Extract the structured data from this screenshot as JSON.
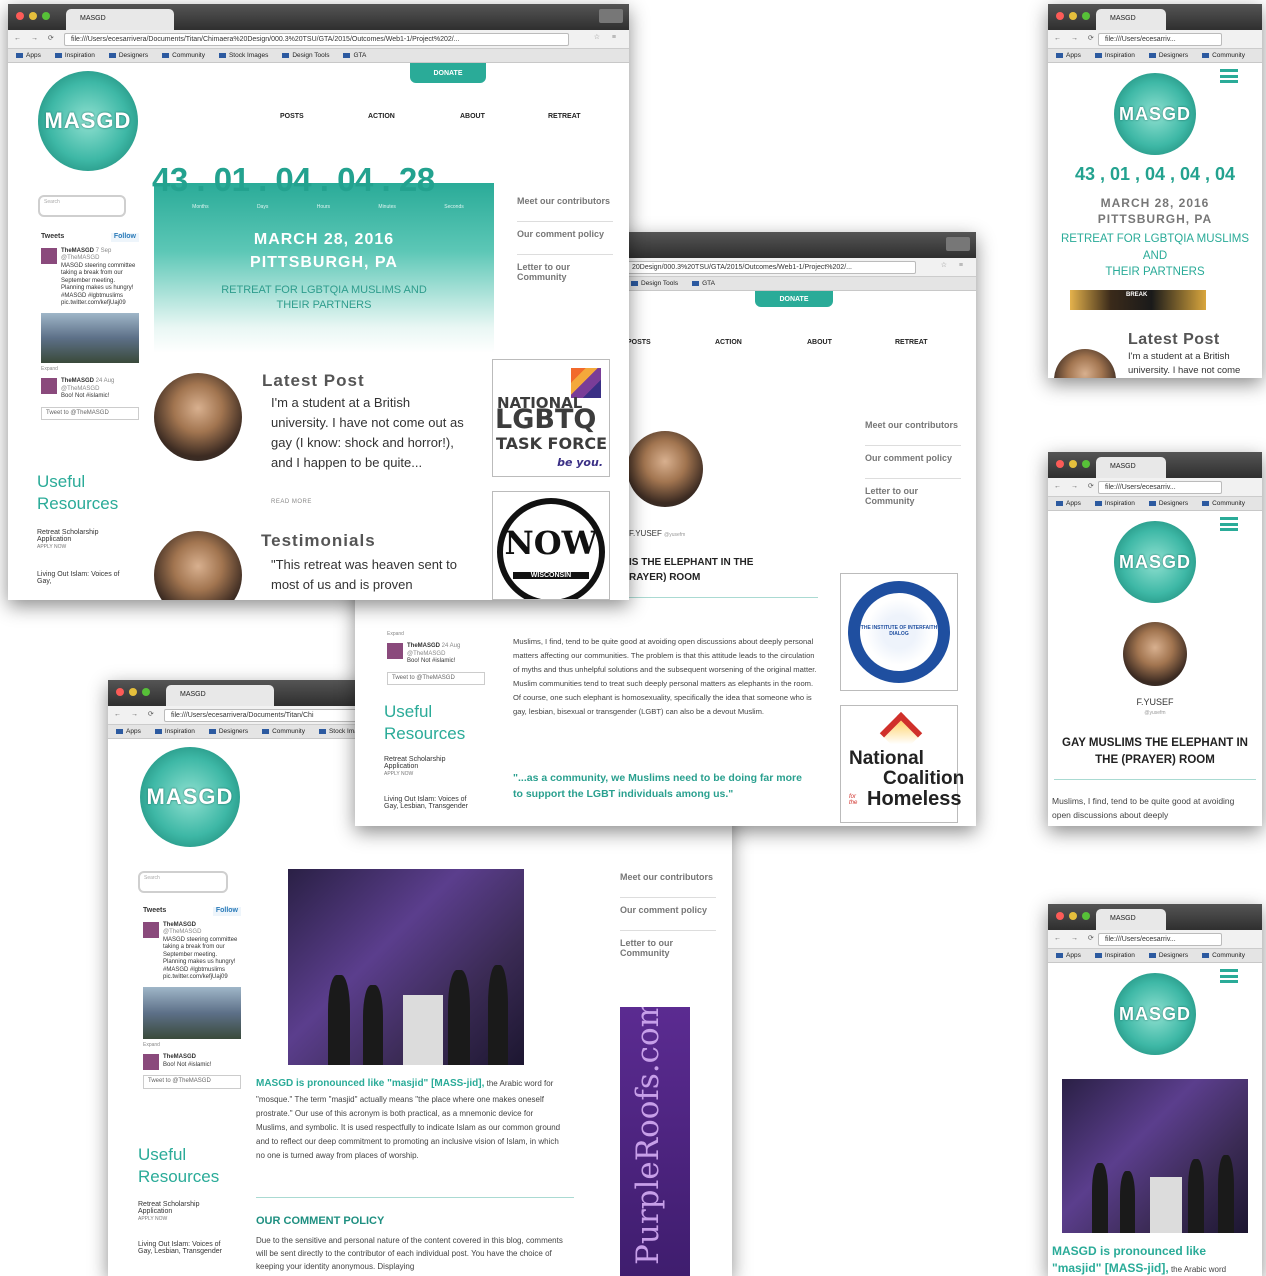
{
  "tab": {
    "title": "MASGD"
  },
  "url": {
    "w1": "file:///Users/ecesarrivera/Documents/Titan/Chimaera%20Design/000.3%20TSU/GTA/2015/Outcomes/Web1-1/Project%202/...",
    "w2": "20Design/000.3%20TSU/GTA/2015/Outcomes/Web1-1/Project%202/...",
    "w3": "file:///Users/ecesarrivera/Documents/Titan/Chi",
    "m": "file:///Users/ecesarriv..."
  },
  "bookmarks": [
    "Apps",
    "Inspiration",
    "Designers",
    "Community",
    "Stock Images",
    "Design Tools",
    "GTA"
  ],
  "logo": "MASGD",
  "nav": {
    "donate": "DONATE",
    "posts": "POSTS",
    "action": "ACTION",
    "about": "ABOUT",
    "retreat": "RETREAT"
  },
  "search": "Search",
  "countdown": {
    "value": "43 . 01 . 04 . 04 . 28",
    "units": [
      "Months",
      "Days",
      "Hours",
      "Minutes",
      "Seconds"
    ],
    "mobile": "43 , 01 , 04 , 04 , 04"
  },
  "event": {
    "date": "MARCH 28, 2016",
    "place": "PITTSBURGH, PA",
    "tagline": "RETREAT FOR LGBTQIA MUSLIMS AND THEIR PARTNERS",
    "m_tag1": "RETREAT FOR LGBTQIA MUSLIMS",
    "m_tag2": "AND",
    "m_tag3": "THEIR PARTNERS"
  },
  "sidebar": {
    "contributors": "Meet our contributors",
    "comment": "Our comment policy",
    "letter": "Letter to our Community"
  },
  "tweets": {
    "title": "Tweets",
    "follow": "Follow",
    "name": "TheMASGD",
    "handle": "@TheMASGD",
    "date1": "7 Sep",
    "text1": "MASGD steering committee taking a break from our September meeting. Planning makes us hungry! #MASGD #lgbtmuslims pic.twitter.com/kefjUaj09",
    "expand": "Expand",
    "date2": "24 Aug",
    "text2": "Boo! Not #islamic!",
    "tweetto": "Tweet to @TheMASGD"
  },
  "resources": {
    "title": "Useful Resources",
    "r1": "Retreat Scholarship Application",
    "r1b": "APPLY NOW",
    "r2": "Living Out Islam: Voices of Gay,",
    "r2b": "Lesbian, Transgender"
  },
  "latest": {
    "title": "Latest Post",
    "text": "I'm a student at a British university. I have not come out as gay (I know: shock and horror!), and I happen to be quite...",
    "more": "READ MORE",
    "m_text": "I'm a student at a British university. I have not come"
  },
  "testimonials": {
    "title": "Testimonials",
    "text": "\"This retreat was heaven sent to most of us and is proven"
  },
  "sponsor": {
    "ntf1": "NATIONAL",
    "ntf2": "LGBTQ",
    "ntf3": "TASK FORCE",
    "ntf4": "be you.",
    "now": "NOW",
    "now2": "WISCONSIN",
    "nc1": "National",
    "nc2": "Coalition",
    "nc3": "for the",
    "nc4": "Homeless",
    "inst": "THE INSTITUTE OF INTERFAITH DIALOG",
    "purple": "PurpleRoofs.com",
    "break": "BREAK"
  },
  "post": {
    "author": "F.YUSEF",
    "handle": "@yusefm",
    "title": "GAY MUSLIMS THE ELEPHANT IN THE (PRAYER) ROOM",
    "title_cut1": "IS THE ELEPHANT IN THE",
    "title_cut2": "RAYER) ROOM",
    "body": "Muslims, I find, tend to be quite good at avoiding open discussions about deeply personal matters affecting our communities. The problem is that this attitude leads to the circulation of myths and thus unhelpful solutions and the subsequent worsening of the original matter. Muslim communities tend to treat such deeply personal matters as elephants in the room. Of course, one such elephant is homosexuality, specifically the idea that someone who is gay, lesbian, bisexual or transgender (LGBT) can also be a devout Muslim.",
    "quote": "\"...as a community, we Muslims need to be doing far more to support the LGBT individuals among us.\"",
    "m_body": "Muslims, I find, tend to be quite good at avoiding open discussions about deeply"
  },
  "about": {
    "lead": "MASGD is pronounced like \"masjid\" [MASS-jid],",
    "text": " the Arabic word for \"mosque.\" The term \"masjid\" actually means \"the place where one makes oneself prostrate.\" Our use of this acronym is both practical, as a mnemonic device for Muslims, and symbolic. It is used respectfully to indicate Islam as our common ground and to reflect our deep commitment to promoting an inclusive vision of Islam, in which no one is turned away from places of worship.",
    "m_lead": "MASGD is pronounced like \"masjid\" [MASS-jid],",
    "m_text": " the Arabic word"
  },
  "policy": {
    "title": "OUR COMMENT POLICY",
    "text": "Due to the sensitive and personal nature of the content covered in this blog, comments will be sent directly to the contributor of each individual post. You have the choice of keeping your identity anonymous. Displaying"
  }
}
